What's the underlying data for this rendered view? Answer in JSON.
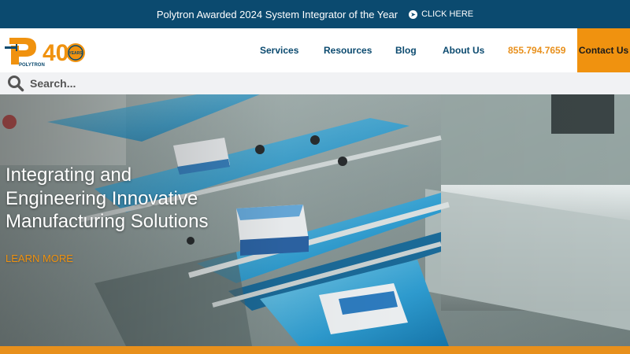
{
  "announcement": {
    "message": "Polytron Awarded 2024 System Integrator of the Year",
    "cta_label": "CLICK HERE"
  },
  "header": {
    "logo_text": "POLYTRON",
    "logo_anniversary": "40",
    "logo_seal": "YEARS",
    "nav": [
      "Services",
      "Resources",
      "Blog",
      "About Us"
    ],
    "phone": "855.794.7659",
    "contact_label": "Contact Us"
  },
  "search": {
    "placeholder": "Search..."
  },
  "hero": {
    "title_lines": [
      "Integrating and",
      "Engineering Innovative",
      "Manufacturing Solutions"
    ],
    "cta_label": "LEARN MORE"
  },
  "colors": {
    "brand_blue": "#0b4a6f",
    "accent_orange": "#f0920f",
    "conveyor_blue": "#2f9fd4"
  }
}
